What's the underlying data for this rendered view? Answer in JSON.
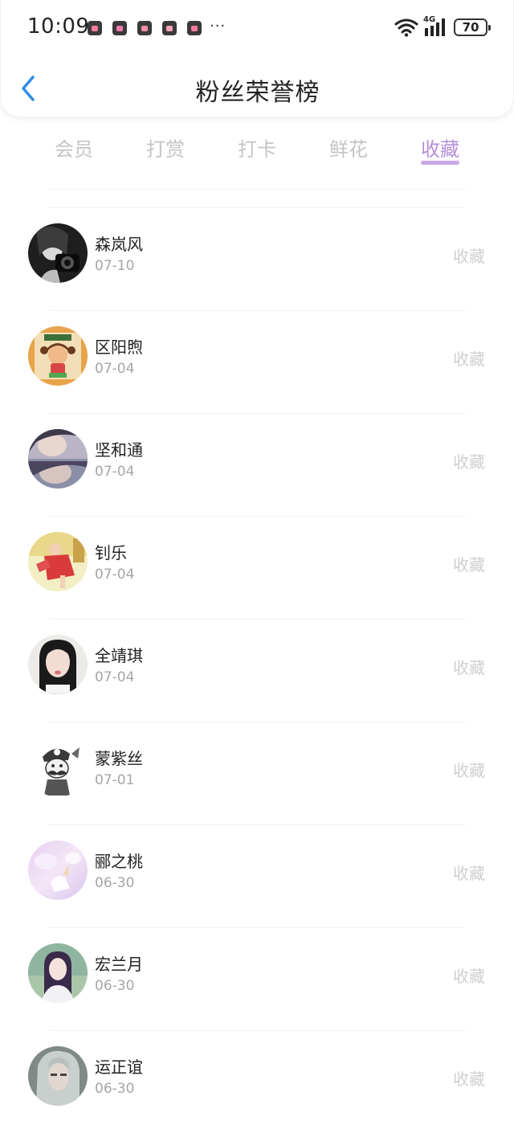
{
  "status_bar": {
    "time": "10:09",
    "more": "···",
    "network": "4G",
    "battery": "70",
    "notification_colors": [
      "#ff7a9c",
      "#f27bb0",
      "#ff8fa8",
      "#ff9fb8",
      "#ff7aa0"
    ]
  },
  "nav": {
    "back_icon": "chevron-left-icon",
    "title": "粉丝荣誉榜",
    "accent": "#2f8ee8"
  },
  "tabs": [
    {
      "label": "会员",
      "active": false
    },
    {
      "label": "打赏",
      "active": false
    },
    {
      "label": "打卡",
      "active": false
    },
    {
      "label": "鲜花",
      "active": false
    },
    {
      "label": "收藏",
      "active": true
    }
  ],
  "colors": {
    "tab_active": "#b48fd6",
    "tab_inactive": "#c4c4c4",
    "action_text": "#cfcfcf",
    "date_text": "#a6a6a6"
  },
  "fans": [
    {
      "name": "森岚风",
      "date": "07-10",
      "action": "收藏",
      "avatar": "photo-bw-camera"
    },
    {
      "name": "区阳煦",
      "date": "07-04",
      "action": "收藏",
      "avatar": "cartoon-girl-orange"
    },
    {
      "name": "坚和通",
      "date": "07-04",
      "action": "收藏",
      "avatar": "photo-twins"
    },
    {
      "name": "钊乐",
      "date": "07-04",
      "action": "收藏",
      "avatar": "photo-red-dress"
    },
    {
      "name": "全靖琪",
      "date": "07-04",
      "action": "收藏",
      "avatar": "photo-girl-portrait"
    },
    {
      "name": "蒙紫丝",
      "date": "07-01",
      "action": "收藏",
      "avatar": "cartoon-mustache"
    },
    {
      "name": "郦之桃",
      "date": "06-30",
      "action": "收藏",
      "avatar": "pastel-unicorn"
    },
    {
      "name": "宏兰月",
      "date": "06-30",
      "action": "收藏",
      "avatar": "photo-girl-trees"
    },
    {
      "name": "运正谊",
      "date": "06-30",
      "action": "收藏",
      "avatar": "photo-grey-hair"
    }
  ]
}
